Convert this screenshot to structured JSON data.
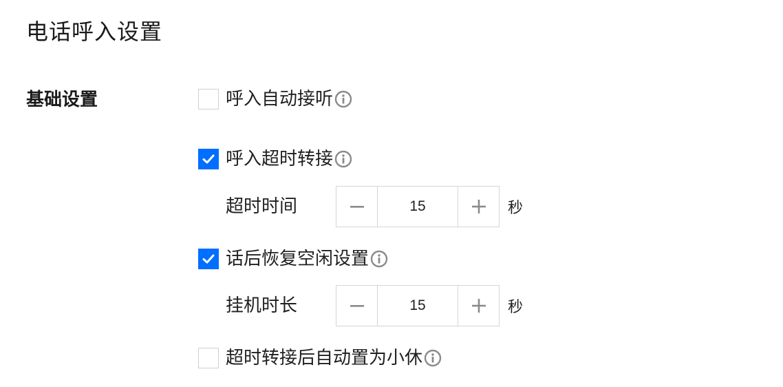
{
  "page": {
    "title": "电话呼入设置"
  },
  "basic": {
    "label": "基础设置",
    "options": [
      {
        "label": "呼入自动接听",
        "checked": false,
        "info_icon": "info-circle-icon"
      },
      {
        "label": "呼入超时转接",
        "checked": true,
        "info_icon": "info-circle-icon"
      },
      {
        "label": "话后恢复空闲设置",
        "checked": true,
        "info_icon": "info-circle-icon"
      },
      {
        "label": "超时转接后自动置为小休",
        "checked": false,
        "info_icon": "info-circle-icon"
      }
    ],
    "timeout": {
      "label": "超时时间",
      "value": "15",
      "unit": "秒"
    },
    "hangup": {
      "label": "挂机时长",
      "value": "15",
      "unit": "秒"
    }
  },
  "colors": {
    "accent": "#006eff",
    "border": "#d5d5d5",
    "icon": "#8a8a8a"
  },
  "icons": {
    "check": "check-icon",
    "minus": "minus-icon",
    "plus": "plus-icon",
    "info": "info-circle-icon"
  }
}
